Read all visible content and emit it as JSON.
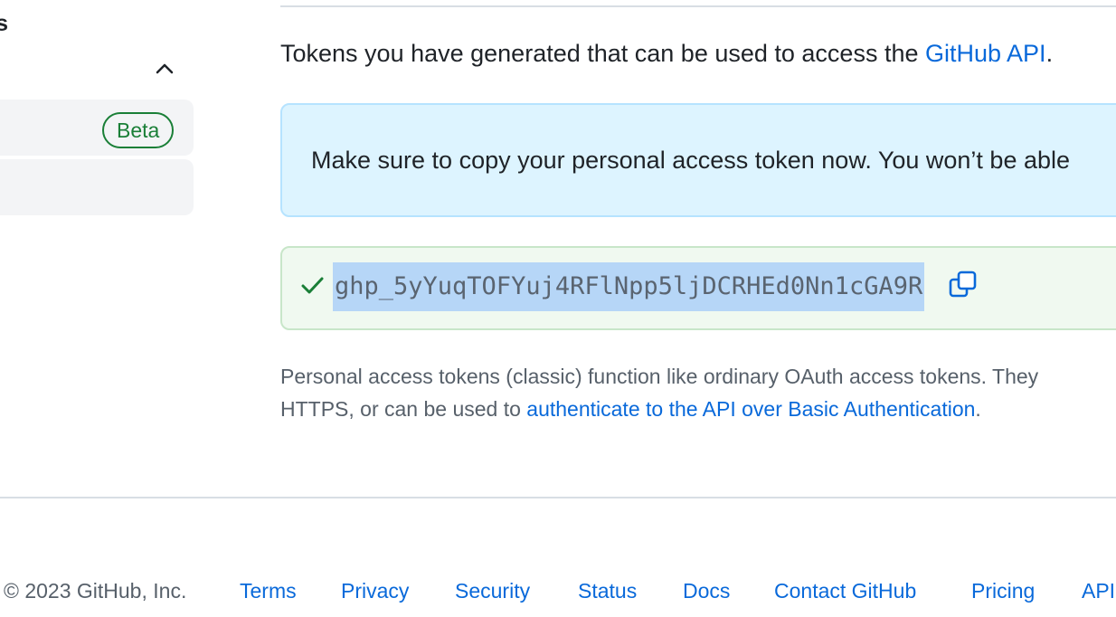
{
  "sidebar": {
    "group_title": "ens",
    "items": [
      {
        "badge": "Beta"
      },
      {}
    ]
  },
  "main": {
    "intro_text": "Tokens you have generated that can be used to access the ",
    "intro_link": "GitHub API",
    "intro_suffix": ".",
    "flash_text": "Make sure to copy your personal access token now. You won’t be able",
    "token": "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",
    "description_line1": "Personal access tokens (classic) function like ordinary OAuth access tokens. They",
    "description_line2_prefix": "HTTPS, or can be used to ",
    "description_link": "authenticate to the API over Basic Authentication",
    "description_line2_suffix": "."
  },
  "footer": {
    "copyright": "© 2023 GitHub, Inc.",
    "links": [
      "Terms",
      "Privacy",
      "Security",
      "Status",
      "Docs",
      "Contact GitHub",
      "Pricing",
      "API"
    ]
  },
  "colors": {
    "link": "#0969da",
    "success": "#1a7f37",
    "info_bg": "#ddf4ff",
    "token_highlight": "#b6d6f7"
  },
  "icons": {
    "collapse": "chevron-up-icon",
    "success": "check-icon",
    "copy": "copy-icon"
  }
}
